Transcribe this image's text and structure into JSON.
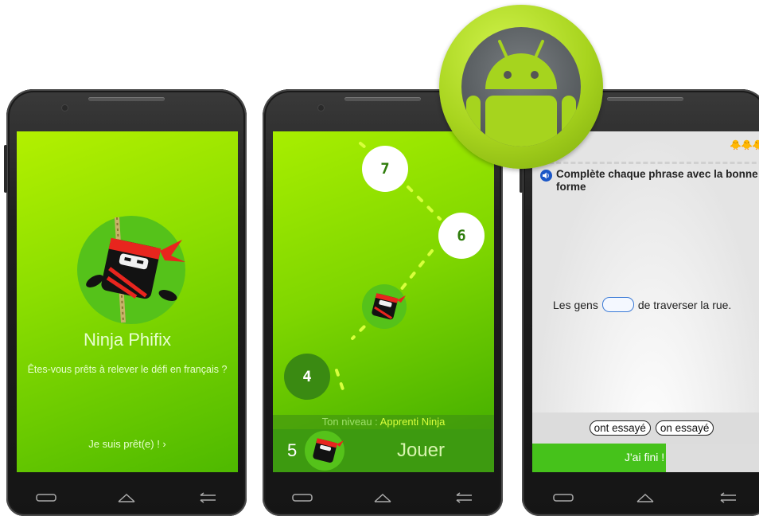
{
  "screen1": {
    "title": "Ninja Phifix",
    "tagline": "Êtes-vous prêts à relever le défi en français ?",
    "ready_label": "Je suis prêt(e) ! ›"
  },
  "screen2": {
    "nodes": [
      "7",
      "6",
      "4"
    ],
    "level_label": "Ton niveau : ",
    "level_value": "Apprenti Ninja",
    "score": "5",
    "play_label": "Jouer"
  },
  "screen3": {
    "instruction": "Complète chaque phrase avec la bonne forme",
    "sentence_before": "Les gens",
    "sentence_after": "de traverser la rue.",
    "choices": [
      "ont essayé",
      "on essayé"
    ],
    "done_label": "J'ai fini !",
    "progress": 0.56
  },
  "icons": {
    "badge": "android-logo",
    "volume": "volume-icon",
    "recent": "recent-apps-icon",
    "home": "home-icon",
    "back": "back-icon"
  },
  "colors": {
    "brand_green": "#8cde00",
    "dark_green": "#3d9a10",
    "level_accent": "#d8ff3c",
    "link_blue": "#1b57c7"
  }
}
